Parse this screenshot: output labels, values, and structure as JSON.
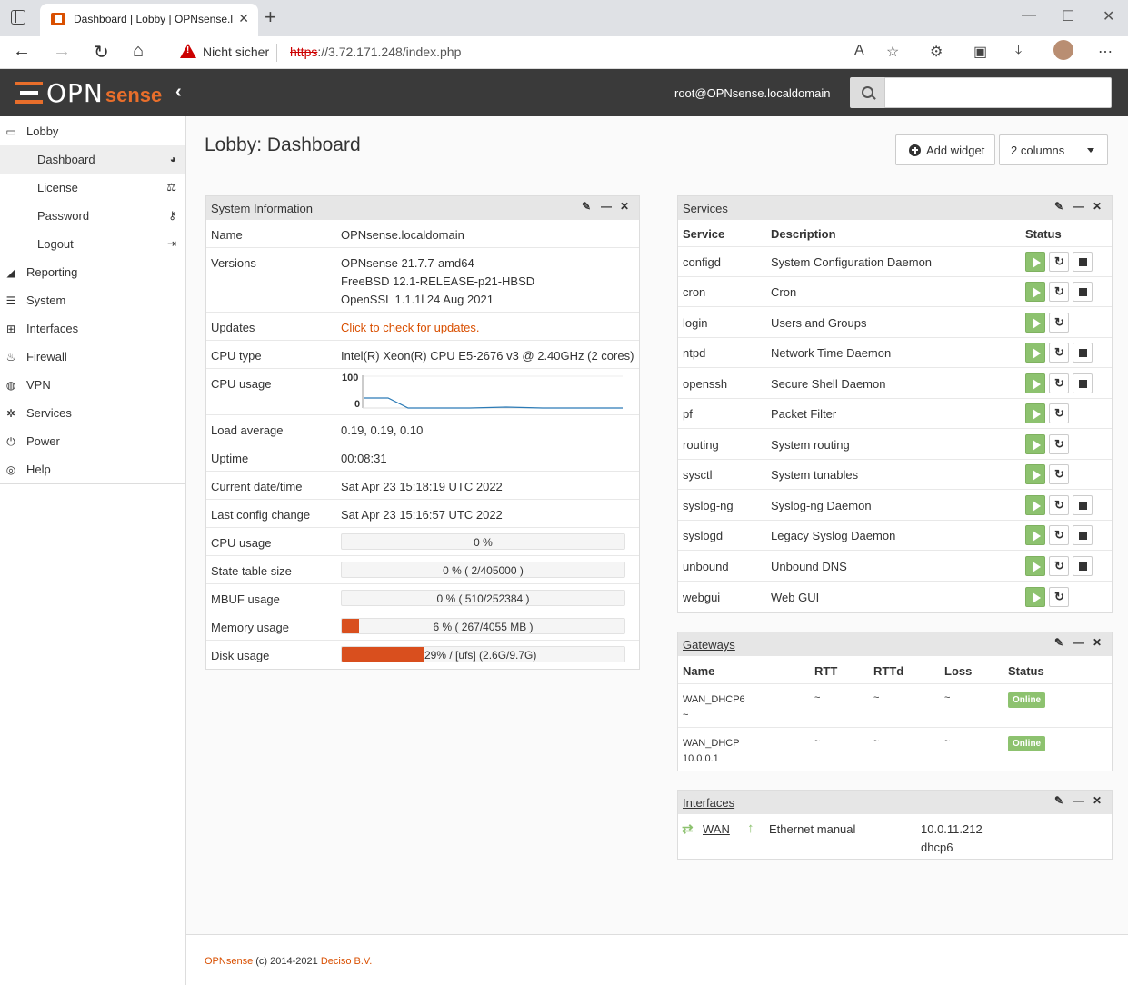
{
  "browser": {
    "tab_title": "Dashboard | Lobby | OPNsense.localdomain",
    "not_secure": "Nicht sicher",
    "url_scheme": "https",
    "url_rest": "://3.72.171.248/index.php"
  },
  "header": {
    "logo_opn": "OPN",
    "logo_sense": "sense",
    "user": "root@OPNsense.localdomain",
    "search_placeholder": ""
  },
  "sidebar": {
    "lobby": "Lobby",
    "lobby_items": [
      {
        "label": "Dashboard"
      },
      {
        "label": "License"
      },
      {
        "label": "Password"
      },
      {
        "label": "Logout"
      }
    ],
    "items": [
      {
        "label": "Reporting"
      },
      {
        "label": "System"
      },
      {
        "label": "Interfaces"
      },
      {
        "label": "Firewall"
      },
      {
        "label": "VPN"
      },
      {
        "label": "Services"
      },
      {
        "label": "Power"
      },
      {
        "label": "Help"
      }
    ]
  },
  "page": {
    "title": "Lobby: Dashboard",
    "add_widget": "Add widget",
    "columns": "2 columns"
  },
  "sysinfo": {
    "title": "System Information",
    "rows": {
      "name_label": "Name",
      "name": "OPNsense.localdomain",
      "versions_label": "Versions",
      "v1": "OPNsense 21.7.7-amd64",
      "v2": "FreeBSD 12.1-RELEASE-p21-HBSD",
      "v3": "OpenSSL 1.1.1l 24 Aug 2021",
      "updates_label": "Updates",
      "updates": "Click to check for updates.",
      "cputype_label": "CPU type",
      "cputype": "Intel(R) Xeon(R) CPU E5-2676 v3 @ 2.40GHz (2 cores)",
      "cpuusage_label": "CPU usage",
      "graph_max": "100",
      "graph_min": "0",
      "load_label": "Load average",
      "load": "0.19, 0.19, 0.10",
      "uptime_label": "Uptime",
      "uptime": "00:08:31",
      "date_label": "Current date/time",
      "date": "Sat Apr 23 15:18:19 UTC 2022",
      "lastcfg_label": "Last config change",
      "lastcfg": "Sat Apr 23 15:16:57 UTC 2022",
      "cpu2_label": "CPU usage",
      "cpu2": "0 %",
      "state_label": "State table size",
      "state": "0 % ( 2/405000 )",
      "mbuf_label": "MBUF usage",
      "mbuf": "0 % ( 510/252384 )",
      "mem_label": "Memory usage",
      "mem": "6 % ( 267/4055 MB )",
      "disk_label": "Disk usage",
      "disk": "29% / [ufs] (2.6G/9.7G)"
    },
    "levels": {
      "cpu": 0,
      "state": 0,
      "mbuf": 0,
      "mem": 6,
      "disk": 29
    }
  },
  "services": {
    "title": "Services",
    "head": {
      "service": "Service",
      "description": "Description",
      "status": "Status"
    },
    "rows": [
      {
        "name": "configd",
        "desc": "System Configuration Daemon",
        "stop": true
      },
      {
        "name": "cron",
        "desc": "Cron",
        "stop": true
      },
      {
        "name": "login",
        "desc": "Users and Groups",
        "stop": false
      },
      {
        "name": "ntpd",
        "desc": "Network Time Daemon",
        "stop": true
      },
      {
        "name": "openssh",
        "desc": "Secure Shell Daemon",
        "stop": true
      },
      {
        "name": "pf",
        "desc": "Packet Filter",
        "stop": false
      },
      {
        "name": "routing",
        "desc": "System routing",
        "stop": false
      },
      {
        "name": "sysctl",
        "desc": "System tunables",
        "stop": false
      },
      {
        "name": "syslog-ng",
        "desc": "Syslog-ng Daemon",
        "stop": true
      },
      {
        "name": "syslogd",
        "desc": "Legacy Syslog Daemon",
        "stop": true
      },
      {
        "name": "unbound",
        "desc": "Unbound DNS",
        "stop": true
      },
      {
        "name": "webgui",
        "desc": "Web GUI",
        "stop": false
      }
    ]
  },
  "gateways": {
    "title": "Gateways",
    "head": {
      "name": "Name",
      "rtt": "RTT",
      "rttd": "RTTd",
      "loss": "Loss",
      "status": "Status"
    },
    "rows": [
      {
        "name": "WAN_DHCP6",
        "addr": "~",
        "rtt": "~",
        "rttd": "~",
        "loss": "~",
        "status": "Online"
      },
      {
        "name": "WAN_DHCP",
        "addr": "10.0.0.1",
        "rtt": "~",
        "rttd": "~",
        "loss": "~",
        "status": "Online"
      }
    ]
  },
  "interfaces": {
    "title": "Interfaces",
    "name": "WAN",
    "media": "Ethernet manual",
    "ip": "10.0.11.212",
    "ip6": "dhcp6"
  },
  "footer": {
    "product": "OPNsense",
    "copy": " (c) 2014-2021 ",
    "company": "Deciso B.V."
  },
  "colors": {
    "accent": "#d94f00",
    "running": "#8dc26f",
    "header": "#3a3a3a"
  }
}
